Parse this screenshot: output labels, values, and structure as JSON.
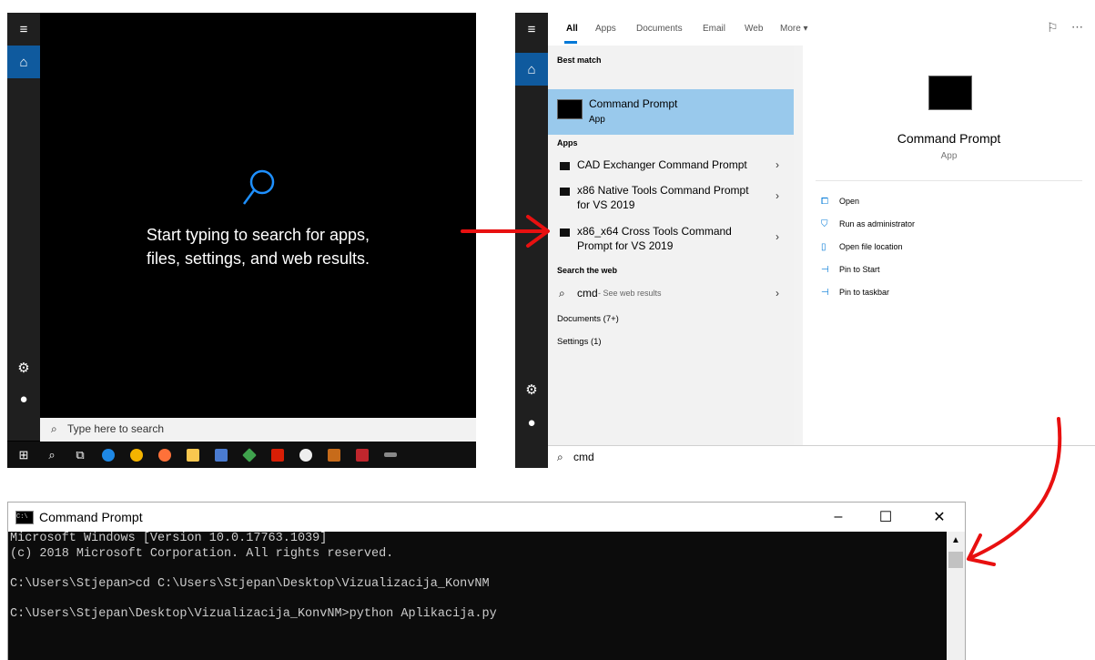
{
  "panel_empty_search": {
    "rail_icons": [
      "hamburger-icon",
      "home-icon",
      "gear-icon",
      "user-icon"
    ],
    "hint_line1": "Start typing to search for apps,",
    "hint_line2": "files, settings, and web results.",
    "search_placeholder": "Type here to search"
  },
  "panel_results": {
    "tabs": [
      "All",
      "Apps",
      "Documents",
      "Email",
      "Web",
      "More ▾"
    ],
    "best_match_label": "Best match",
    "best_match": {
      "title": "Command Prompt",
      "subtitle": "App"
    },
    "apps_label": "Apps",
    "apps": [
      {
        "line1": "CAD Exchanger Command Prompt",
        "line2": ""
      },
      {
        "line1": "x86 Native Tools Command Prompt",
        "line2": "for VS 2019"
      },
      {
        "line1": "x86_x64 Cross Tools Command",
        "line2": "Prompt for VS 2019"
      }
    ],
    "search_web_label": "Search the web",
    "web_query": "cmd",
    "web_hint": " - See web results",
    "documents_label": "Documents (7+)",
    "settings_label": "Settings (1)",
    "preview": {
      "title": "Command Prompt",
      "subtitle": "App"
    },
    "actions": [
      "Open",
      "Run as administrator",
      "Open file location",
      "Pin to Start",
      "Pin to taskbar"
    ],
    "search_value": "cmd"
  },
  "cmd_window": {
    "title": "Command Prompt",
    "lines": [
      "Microsoft Windows [Version 10.0.17763.1039]",
      "(c) 2018 Microsoft Corporation. All rights reserved.",
      "",
      "C:\\Users\\Stjepan>cd C:\\Users\\Stjepan\\Desktop\\Vizualizacija_KonvNM",
      "",
      "C:\\Users\\Stjepan\\Desktop\\Vizualizacija_KonvNM>python Aplikacija.py"
    ]
  },
  "annotation_color": "#e81010"
}
